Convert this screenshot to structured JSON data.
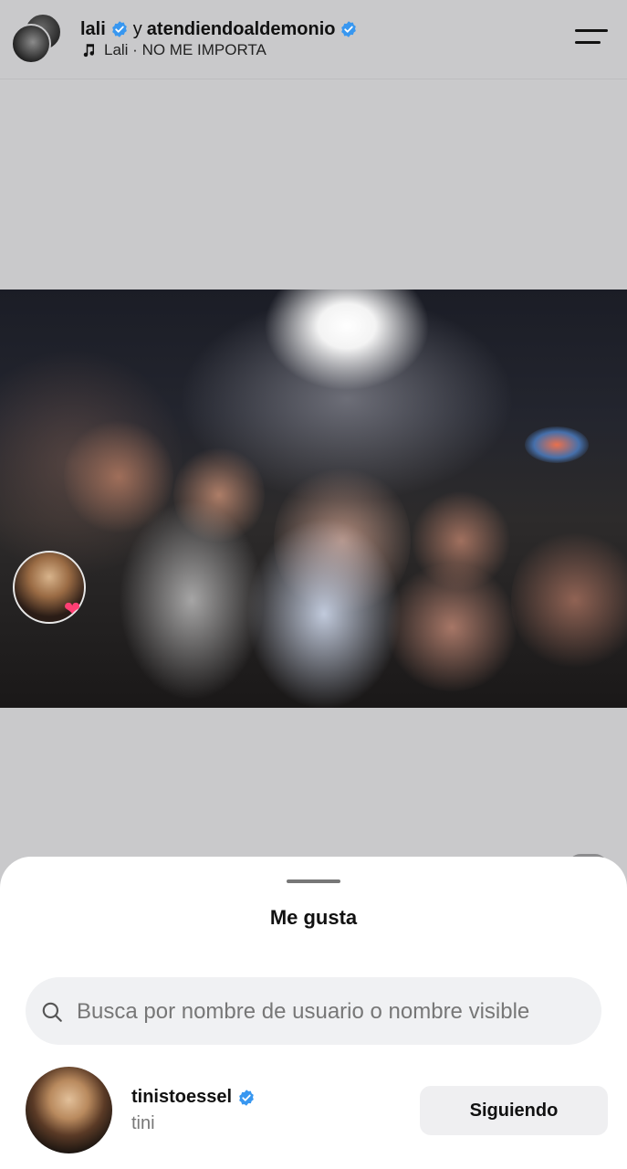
{
  "header": {
    "author1": "lali",
    "connector": "y",
    "author2": "atendiendoaldemonio",
    "music_label": "Lali · NO ME IMPORTA"
  },
  "icons": {
    "menu": "hamburger-menu-icon",
    "music": "music-note-icon",
    "verified": "verified-badge-icon",
    "search": "search-icon",
    "heart": "heart-icon"
  },
  "sheet": {
    "title": "Me gusta",
    "search_placeholder": "Busca por nombre de usuario o nombre visible"
  },
  "likes": [
    {
      "username": "tinistoessel",
      "display_name": "tini",
      "verified": true,
      "button_label": "Siguiendo"
    }
  ],
  "colors": {
    "verified": "#3897f0",
    "heart": "#ff3f73",
    "button_bg": "#efeff1"
  }
}
